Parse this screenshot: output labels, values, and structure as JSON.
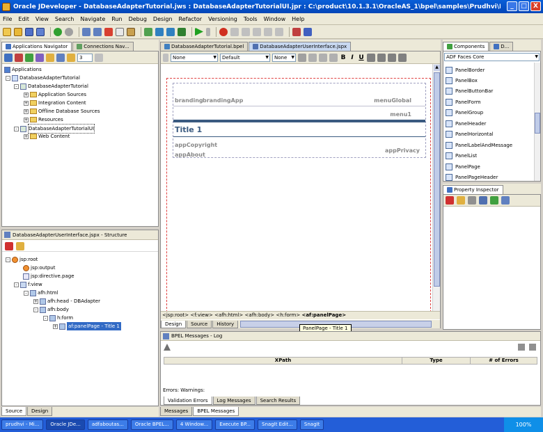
{
  "window": {
    "title": "Oracle JDeveloper - DatabaseAdapterTutorial.jws : DatabaseAdapterTutorialUI.jpr : C:\\product\\10.1.3.1\\OracleAS_1\\bpel\\samples\\Prudhvi\\DatabaseAdapterTut...",
    "buttons": {
      "minimize": "_",
      "maximize": "□",
      "close": "X"
    }
  },
  "menu": [
    "File",
    "Edit",
    "View",
    "Search",
    "Navigate",
    "Run",
    "Debug",
    "Design",
    "Refactor",
    "Versioning",
    "Tools",
    "Window",
    "Help"
  ],
  "nav": {
    "tabs": [
      "Applications Navigator",
      "Connections Nav..."
    ],
    "spinner_value": "3",
    "tree": [
      {
        "label": "Applications",
        "depth": 0
      },
      {
        "label": "DatabaseAdapterTutorial",
        "depth": 1
      },
      {
        "label": "DatabaseAdapterTutorial",
        "depth": 2
      },
      {
        "label": "Application Sources",
        "depth": 3
      },
      {
        "label": "Integration Content",
        "depth": 3
      },
      {
        "label": "Offline Database Sources",
        "depth": 3
      },
      {
        "label": "Resources",
        "depth": 3
      },
      {
        "label": "DatabaseAdapterTutorialUI",
        "depth": 2
      },
      {
        "label": "Web Content",
        "depth": 3
      }
    ]
  },
  "structure": {
    "title": "DatabaseAdapterUserInterface.jspx - Structure",
    "tree": [
      {
        "label": "jsp:root",
        "depth": 0
      },
      {
        "label": "jsp:output",
        "depth": 1
      },
      {
        "label": "jsp:directive.page",
        "depth": 1
      },
      {
        "label": "f:view",
        "depth": 1
      },
      {
        "label": "afh:html",
        "depth": 2
      },
      {
        "label": "afh:head - DBAdapter",
        "depth": 3
      },
      {
        "label": "afh:body",
        "depth": 3
      },
      {
        "label": "h:form",
        "depth": 4
      },
      {
        "label": "af:panelPage - Title 1",
        "depth": 5
      }
    ],
    "bottom_tabs": [
      "Source",
      "Design"
    ]
  },
  "editor": {
    "tabs": [
      "DatabaseAdapterTutorial.bpel",
      "DatabaseAdapterUserInterface.jspx"
    ],
    "style_select": "None",
    "font_select": "Default",
    "size_select": "None",
    "format_buttons": [
      "B",
      "I",
      "U"
    ],
    "page": {
      "branding": "branding",
      "brandingApp": "brandingApp",
      "menuGlobal": "menuGlobal",
      "menu1": "menu1",
      "title": "Title 1",
      "appCopyright": "appCopyright",
      "appAbout": "appAbout",
      "appPrivacy": "appPrivacy"
    },
    "breadcrumb": [
      "<jsp:root>",
      "<f:view>",
      "<afh:html>",
      "<afh:body>",
      "<h:form>",
      "<af:panelPage>"
    ],
    "bottom_tabs": [
      "Design",
      "Source",
      "History"
    ],
    "tooltip": "PanelPage - Title 1"
  },
  "log": {
    "title": "BPEL Messages - Log",
    "columns": [
      "XPath",
      "Type",
      "# of Errors"
    ],
    "footer": "Errors:  Warnings:",
    "tabs": [
      "Validation Errors",
      "Log Messages",
      "Search Results"
    ],
    "bottom_tabs": [
      "Messages",
      "BPEL Messages"
    ]
  },
  "components": {
    "tabs": [
      "Components",
      "D..."
    ],
    "palette": "ADF Faces Core",
    "items": [
      "PanelBorder",
      "PanelBox",
      "PanelButtonBar",
      "PanelForm",
      "PanelGroup",
      "PanelHeader",
      "PanelHorizontal",
      "PanelLabelAndMessage",
      "PanelList",
      "PanelPage",
      "PanelPageHeader"
    ]
  },
  "inspector": {
    "title": "Property Inspector"
  },
  "taskbar": {
    "items": [
      "prudhvi - Mi...",
      "Oracle JDe...",
      "adfaboutas...",
      "Oracle BPEL...",
      "4 Window...",
      "Execute BP...",
      "SnagIt Edit...",
      "SnagIt"
    ],
    "zoom": "100%"
  }
}
